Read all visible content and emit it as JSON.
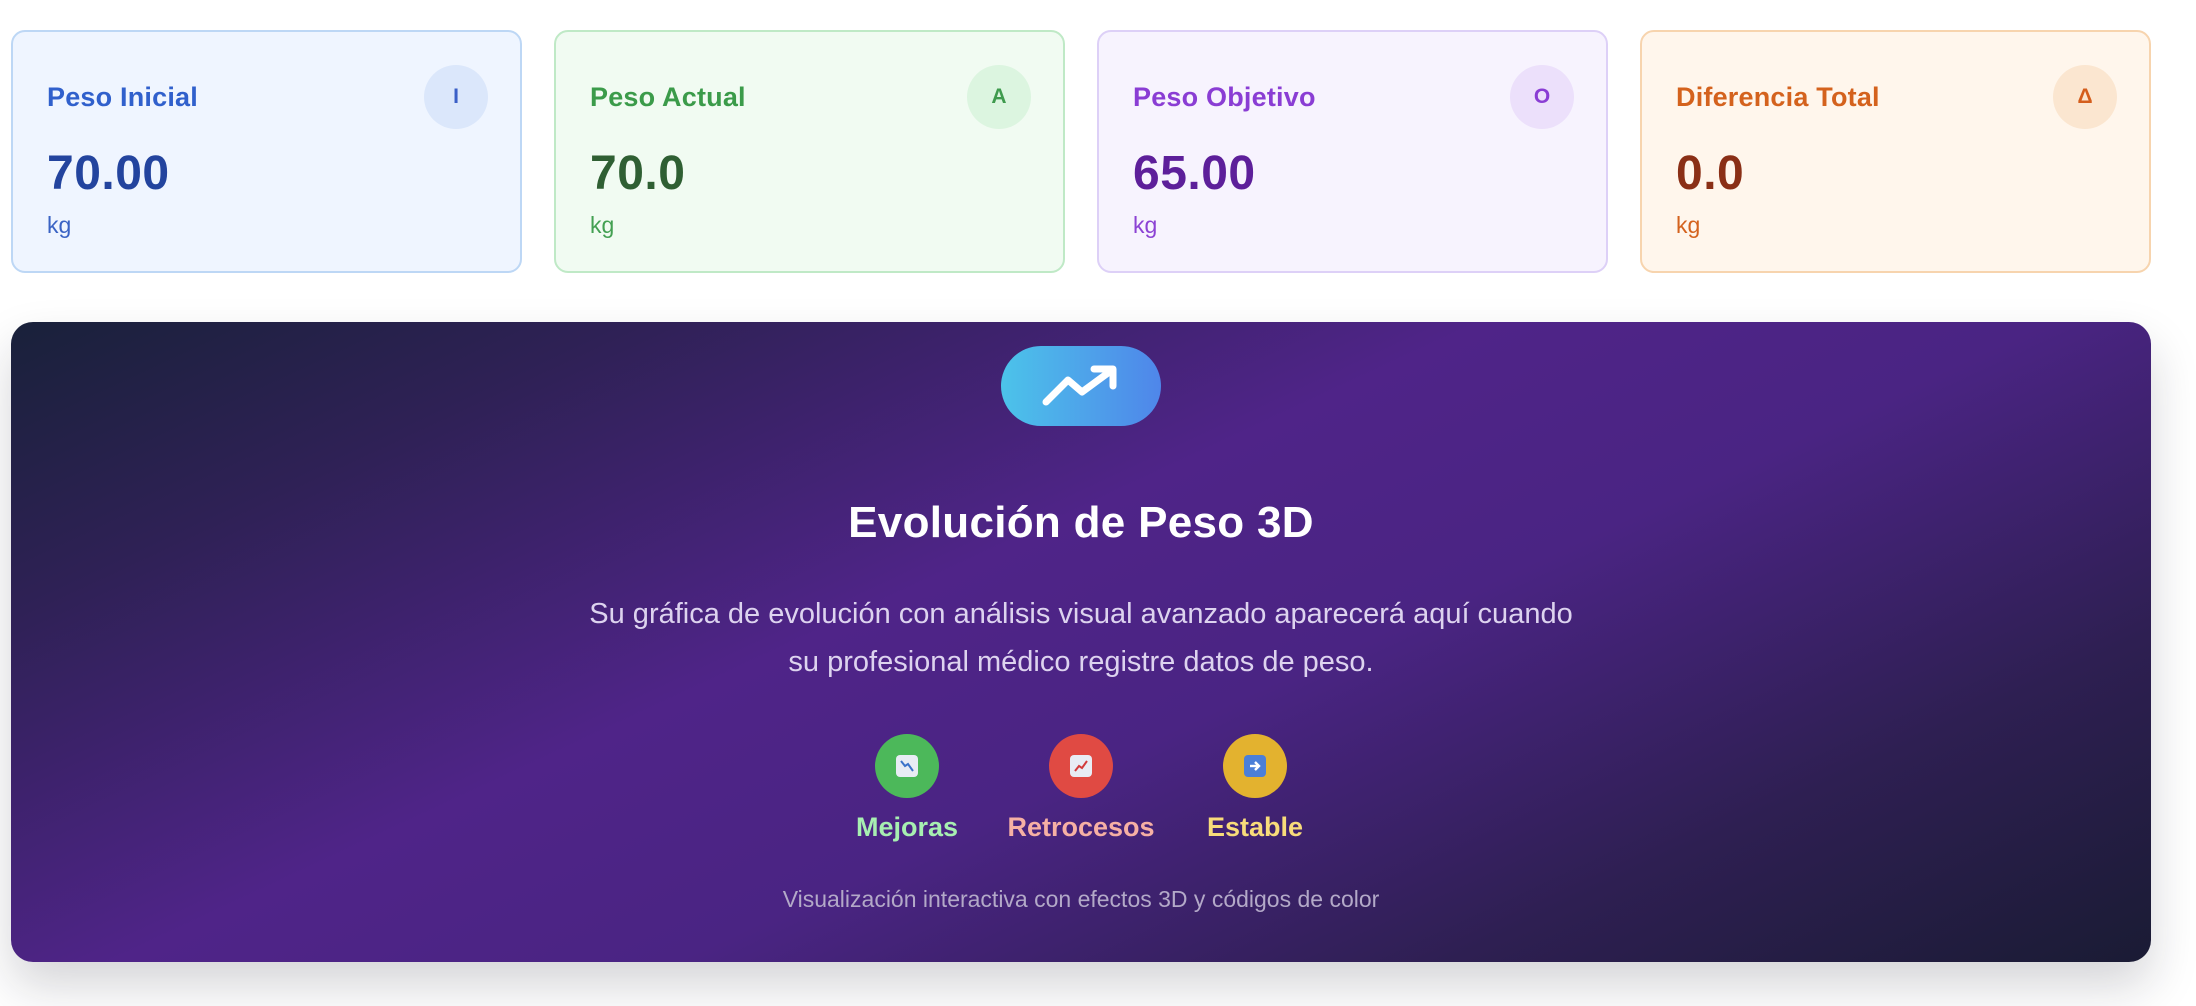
{
  "cards": [
    {
      "title": "Peso Inicial",
      "badge": "I",
      "value": "70.00",
      "unit": "kg"
    },
    {
      "title": "Peso Actual",
      "badge": "A",
      "value": "70.0",
      "unit": "kg"
    },
    {
      "title": "Peso Objetivo",
      "badge": "O",
      "value": "65.00",
      "unit": "kg"
    },
    {
      "title": "Diferencia Total",
      "badge": "Δ",
      "value": "0.0",
      "unit": "kg"
    }
  ],
  "hero": {
    "icon": "trending-up-icon",
    "title": "Evolución de Peso 3D",
    "description": "Su gráfica de evolución con análisis visual avanzado aparecerá aquí cuando su profesional médico registre datos de peso.",
    "legend": [
      {
        "label": "Mejoras",
        "icon": "chart-decreasing-icon",
        "color": "#4cb85a",
        "label_color": "#a7efb1"
      },
      {
        "label": "Retrocesos",
        "icon": "chart-increasing-icon",
        "color": "#e04a43",
        "label_color": "#f6b0a4"
      },
      {
        "label": "Estable",
        "icon": "right-arrow-icon",
        "color": "#e3b22f",
        "label_color": "#f8dc7a"
      }
    ],
    "footer": "Visualización interactiva con efectos 3D y códigos de color"
  },
  "colors": {
    "hero_gradient_start": "#19213a",
    "hero_gradient_mid": "#4f2488",
    "hero_gradient_end": "#1a1b34",
    "hero_icon_start": "#4cc3ea",
    "hero_icon_end": "#4f86ea"
  }
}
